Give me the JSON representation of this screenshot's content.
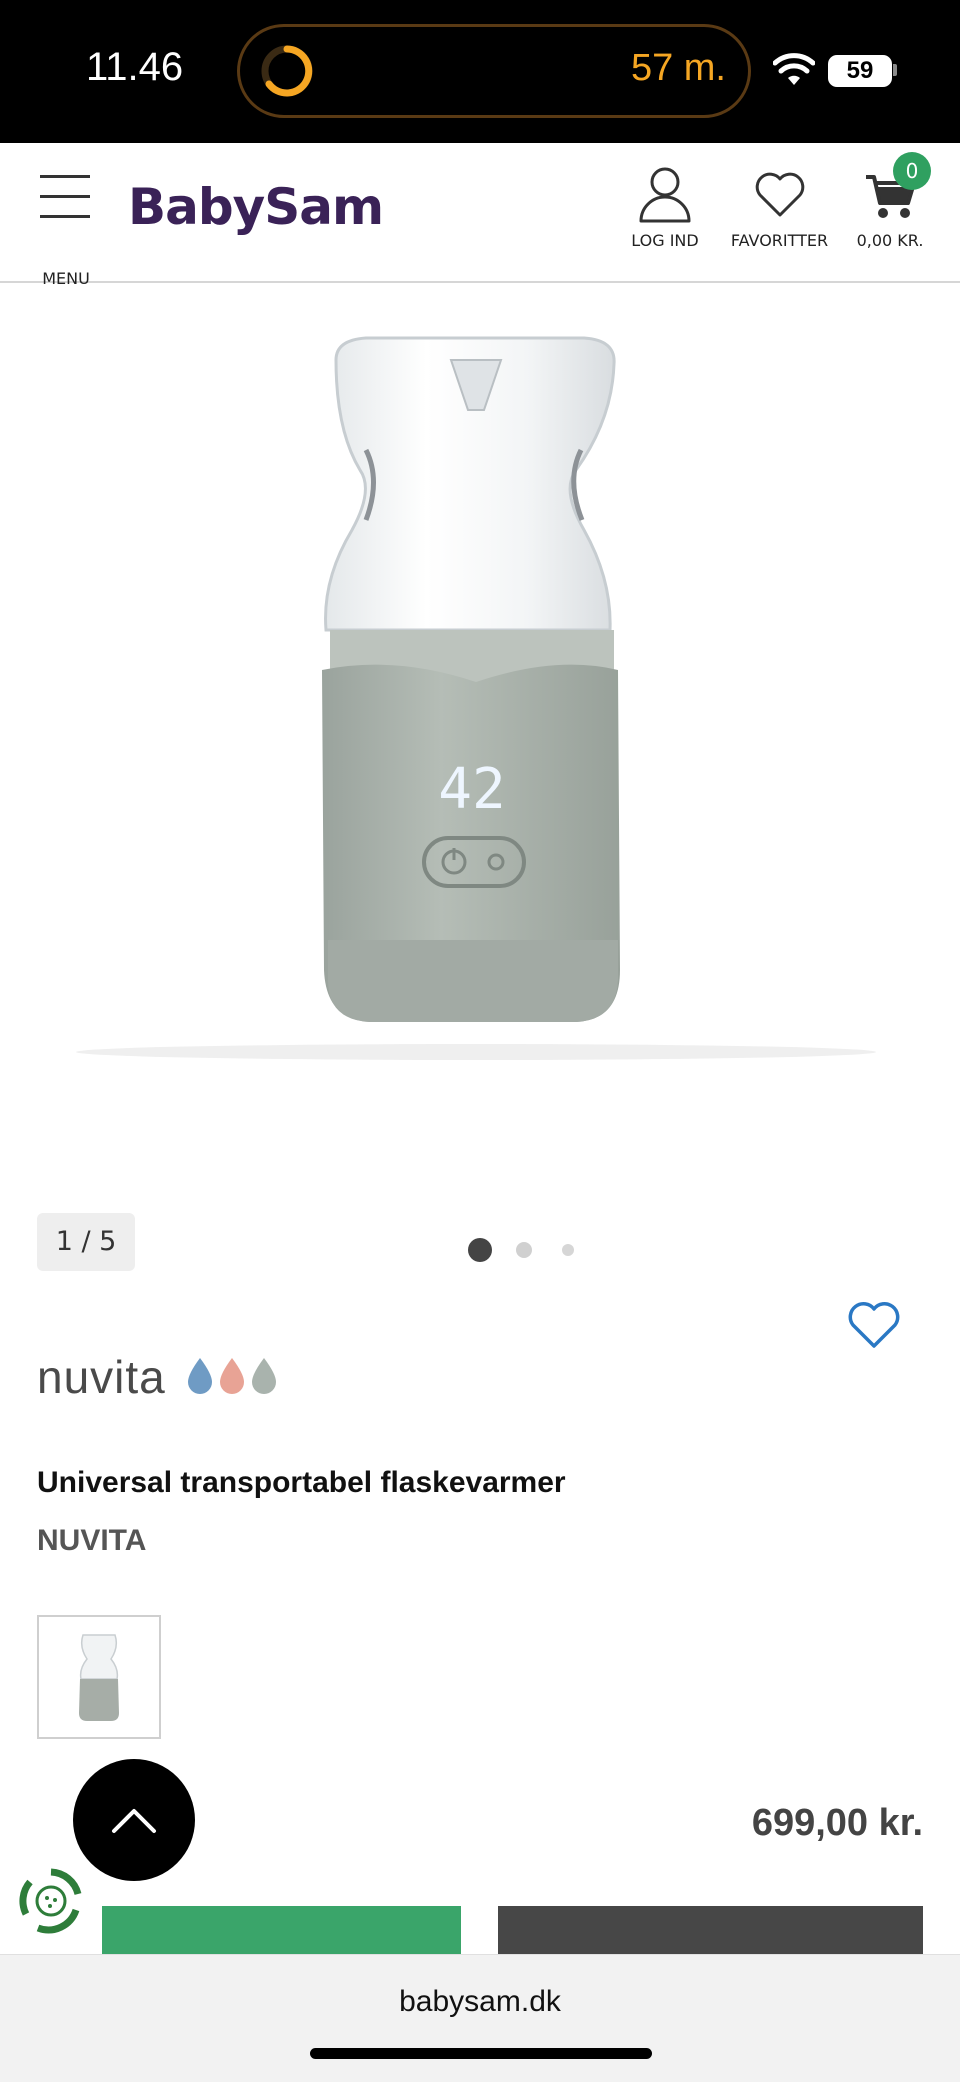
{
  "status_bar": {
    "time": "11.46",
    "timer": "57 m.",
    "battery": "59",
    "timer_color": "#f5a623"
  },
  "header": {
    "menu_label": "MENU",
    "logo": "BabySam",
    "login_label": "LOG IND",
    "favorites_label": "FAVORITTER",
    "cart_label": "0,00 KR.",
    "cart_count": "0",
    "brand_color": "#3a2257",
    "badge_color": "#2fa060"
  },
  "gallery": {
    "counter": "1 / 5",
    "display_digits": "42",
    "dots_total": 3,
    "dots_active": 1
  },
  "product": {
    "brand_logo_text": "nuvita",
    "title": "Universal transportabel flaskevarmer",
    "brand": "NUVITA",
    "price": "699,00 kr."
  },
  "browser": {
    "url": "babysam.dk"
  },
  "icons": [
    "timer-icon",
    "wifi-icon",
    "battery-icon",
    "menu-icon",
    "user-icon",
    "heart-icon",
    "cart-icon",
    "favorite-heart-icon",
    "chevron-up-icon",
    "eco-recycle-icon"
  ]
}
